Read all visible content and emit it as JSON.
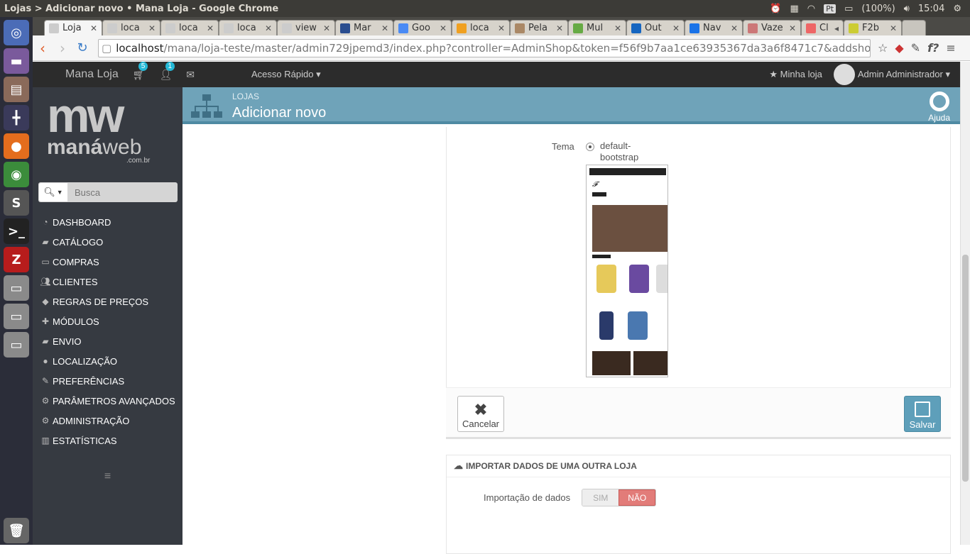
{
  "window": {
    "title": "Lojas > Adicionar novo • Mana Loja - Google Chrome",
    "battery": "(100%)",
    "time": "15:04",
    "lang": "Pt"
  },
  "tabs": [
    {
      "label": "Loja",
      "active": true
    },
    {
      "label": "loca"
    },
    {
      "label": "loca"
    },
    {
      "label": "loca"
    },
    {
      "label": "view"
    },
    {
      "label": "Mar"
    },
    {
      "label": "Goo"
    },
    {
      "label": "loca"
    },
    {
      "label": "Pela"
    },
    {
      "label": "Mul"
    },
    {
      "label": "Out"
    },
    {
      "label": "Nav"
    },
    {
      "label": "Vaze"
    },
    {
      "label": "Cl"
    },
    {
      "label": "F2b"
    }
  ],
  "address": {
    "host": "localhost",
    "path": "/mana/loja-teste/master/admin729jpemd3/index.php?controller=AdminShop&token=f56f9b7aa1ce63935367da3a6f8471c7&addshop&"
  },
  "header": {
    "shop_name": "Mana Loja",
    "cart_badge": "5",
    "user_badge": "1",
    "quick_access": "Acesso Rápido",
    "my_shop": "Minha loja",
    "admin_name": "Admin Administrador"
  },
  "sidebar": {
    "logo_mw": "mw",
    "logo_mana": "maná",
    "logo_web": "web",
    "logo_combr": ".com.br",
    "search_placeholder": "Busca",
    "items": [
      {
        "label": "DASHBOARD",
        "icon": "dashboard-icon"
      },
      {
        "label": "CATÁLOGO",
        "icon": "book-icon"
      },
      {
        "label": "COMPRAS",
        "icon": "credit-card-icon"
      },
      {
        "label": "CLIENTES",
        "icon": "users-icon"
      },
      {
        "label": "REGRAS DE PREÇOS",
        "icon": "tags-icon"
      },
      {
        "label": "MÓDULOS",
        "icon": "puzzle-icon"
      },
      {
        "label": "ENVIO",
        "icon": "truck-icon"
      },
      {
        "label": "LOCALIZAÇÃO",
        "icon": "globe-icon"
      },
      {
        "label": "PREFERÊNCIAS",
        "icon": "wrench-icon"
      },
      {
        "label": "PARÂMETROS AVANÇADOS",
        "icon": "cogs-icon"
      },
      {
        "label": "ADMINISTRAÇÃO",
        "icon": "cog-icon"
      },
      {
        "label": "ESTATÍSTICAS",
        "icon": "bar-chart-icon"
      }
    ]
  },
  "toolbar": {
    "breadcrumb": "LOJAS",
    "title": "Adicionar novo",
    "help": "Ajuda"
  },
  "form": {
    "theme_label": "Tema",
    "theme_name": "default-bootstrap",
    "cancel_label": "Cancelar",
    "save_label": "Salvar"
  },
  "import": {
    "heading": "IMPORTAR DADOS DE UMA OUTRA LOJA",
    "label": "Importação de dados",
    "yes": "SIM",
    "no": "NÃO"
  },
  "colors": {
    "toolbar": "#6fa3b9",
    "sidebar": "#363a41",
    "accent": "#25b9d7",
    "no_active": "#e27c79"
  }
}
